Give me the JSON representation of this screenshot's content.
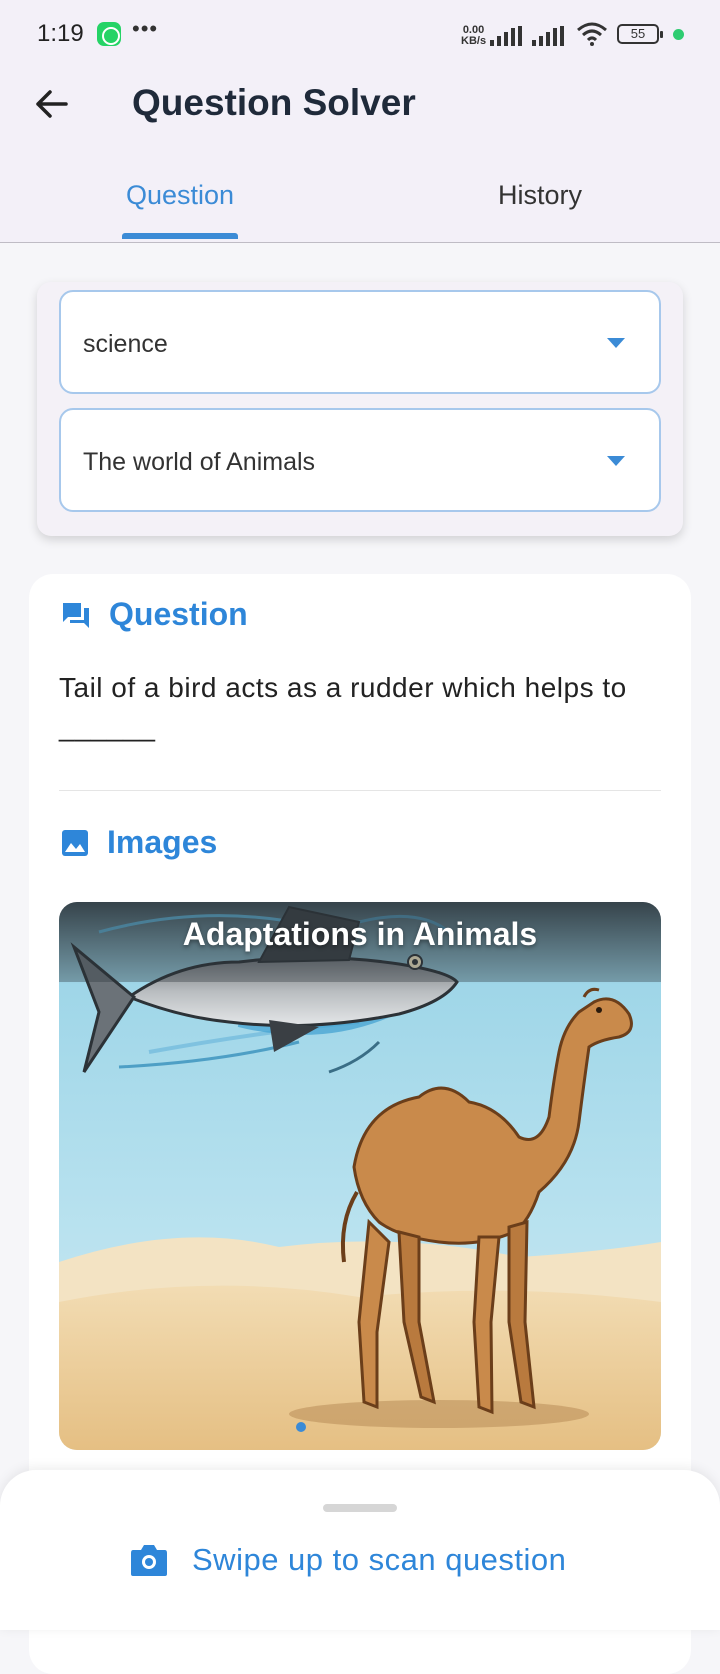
{
  "status_bar": {
    "time": "1:19",
    "net_speed_value": "0.00",
    "net_speed_unit": "KB/s",
    "battery": "55",
    "icons": [
      "whatsapp-icon",
      "more-dots-icon",
      "signal-icon",
      "wifi-icon",
      "battery-icon",
      "green-dot-icon"
    ]
  },
  "app_bar": {
    "title": "Question Solver",
    "back_icon": "arrow-back-icon"
  },
  "tabs": [
    {
      "label": "Question",
      "active": true
    },
    {
      "label": "History",
      "active": false
    }
  ],
  "filters": {
    "subject": "science",
    "chapter": "The world of Animals"
  },
  "question_section": {
    "heading": "Question",
    "icon": "chat-bubble-icon",
    "text": "Tail of a bird acts as a rudder which helps to ______"
  },
  "images_section": {
    "heading": "Images",
    "icon": "image-icon",
    "image_caption": "Adaptations in Animals"
  },
  "bottom_sheet": {
    "label": "Swipe up to scan question",
    "icon": "camera-icon"
  },
  "colors": {
    "accent": "#3b8bd6",
    "title_text": "#1f2a3a",
    "header_bg": "#f3f0f8",
    "page_bg": "#f6f6f9"
  }
}
